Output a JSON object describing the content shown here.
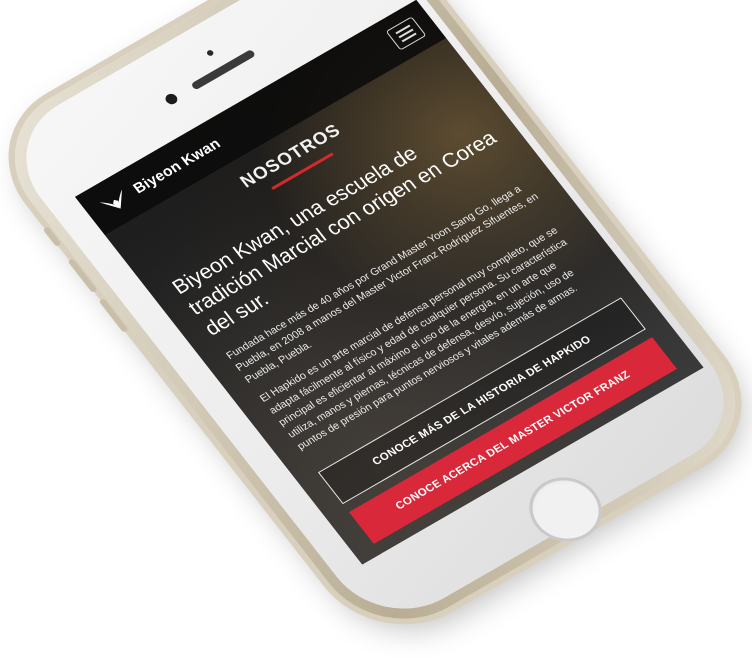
{
  "header": {
    "brand": "Biyeon Kwan",
    "logo_icon": "eagle-wings-icon",
    "menu_icon": "hamburger-menu-icon"
  },
  "section": {
    "title": "NOSOTROS"
  },
  "content": {
    "headline": "Biyeon Kwan, una escuela de tradición Marcial con origen en Corea del sur.",
    "paragraph_1": "Fundada hace más de 40 años por Grand Master Yoon Sang Go, llega a Puebla, en 2008 a manos del Master Victor Franz Rodríguez Sifuentes, en Puebla, Puebla.",
    "paragraph_2": "El Hapkido es un arte marcial de defensa personal muy completo, que se adapta fácilmente al físico y edad de cualquier persona. Su característica principal es eficientar al máximo el uso de la energía, en un arte que utiliza, manos y piernas, técnicas de defensa, desvío, sujeción, uso de puntos de presión para puntos nerviosos y vitales además de armas."
  },
  "buttons": {
    "history": "CONOCE MÁS DE LA HISTORIA DE HAPKIDO",
    "master": "CONOCE ACERCA DEL MASTER VICTOR FRANZ"
  },
  "colors": {
    "accent_red": "#d8283a",
    "screen_bg": "#141414",
    "phone_gold": "#cfc6b2"
  }
}
